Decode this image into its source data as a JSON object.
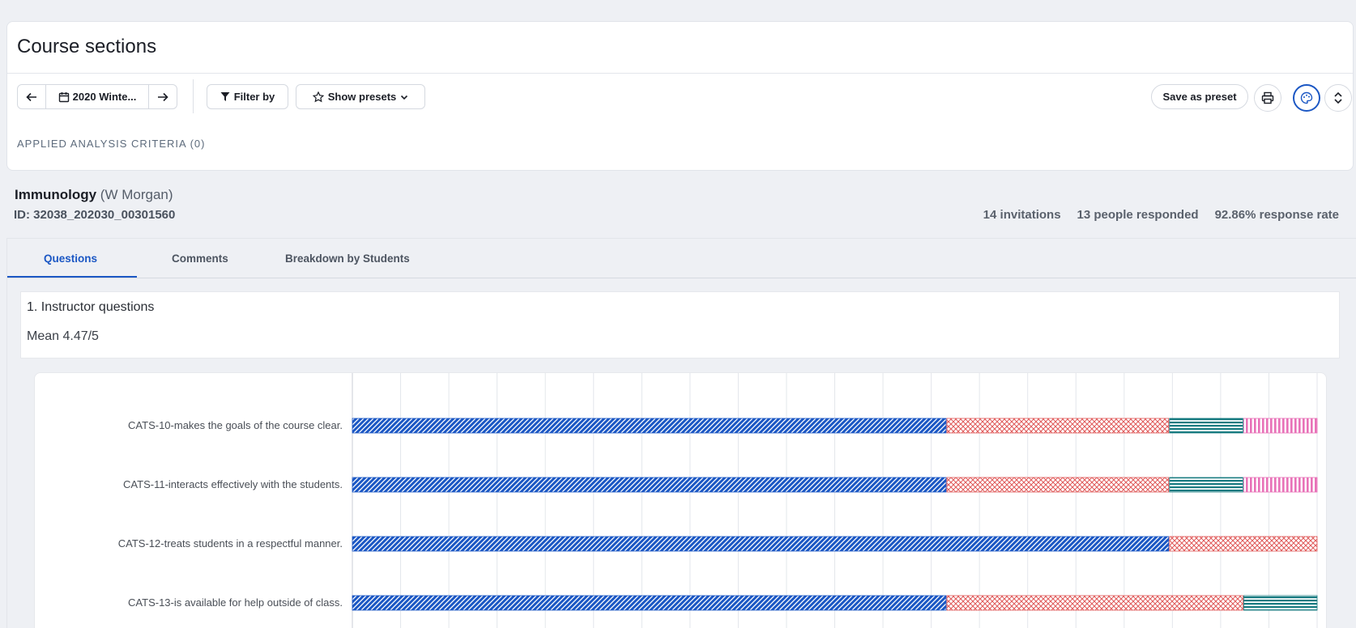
{
  "header": {
    "title": "Course sections"
  },
  "toolbar": {
    "term_label": "2020 Winte...",
    "filter_label": "Filter by",
    "presets_label": "Show presets",
    "save_label": "Save as preset"
  },
  "criteria": {
    "label": "APPLIED ANALYSIS CRITERIA (0)"
  },
  "course": {
    "name": "Immunology",
    "instructor": "(W Morgan)",
    "id": "ID: 32038_202030_00301560",
    "invitations": "14 invitations",
    "responded": "13 people responded",
    "response_rate": "92.86% response rate"
  },
  "tabs": [
    {
      "label": "Questions",
      "active": true
    },
    {
      "label": "Comments",
      "active": false
    },
    {
      "label": "Breakdown by Students",
      "active": false
    }
  ],
  "question": {
    "title": "1. Instructor questions",
    "mean": "Mean 4.47/5"
  },
  "icons": {
    "prev": "arrow-left-icon",
    "next": "arrow-right-icon",
    "calendar": "calendar-icon",
    "filter": "filter-icon",
    "star": "star-icon",
    "chevron": "chevron-down-icon",
    "print": "printer-icon",
    "palette": "palette-icon",
    "expand": "expand-icon"
  },
  "colors": {
    "accent": "#1b57c4",
    "series": [
      "#1b57c4",
      "#e05a5a",
      "#177a80",
      "#e872b8"
    ]
  },
  "chart_data": {
    "type": "bar",
    "orientation": "horizontal",
    "stacked": true,
    "grid": true,
    "categories": [
      "CATS-10-makes the goals of the course clear.",
      "CATS-11-interacts effectively with the students.",
      "CATS-12-treats students in a respectful manner.",
      "CATS-13-is available for help outside of class."
    ],
    "series": [
      {
        "values": [
          8,
          8,
          11,
          8
        ],
        "color": "#1b57c4",
        "pattern": "diagonal-hatch"
      },
      {
        "values": [
          3,
          3,
          2,
          4
        ],
        "color": "#e05a5a",
        "pattern": "cross-hatch"
      },
      {
        "values": [
          1,
          1,
          0,
          1
        ],
        "color": "#177a80",
        "pattern": "horizontal-stripes"
      },
      {
        "values": [
          1,
          1,
          0,
          0
        ],
        "color": "#e872b8",
        "pattern": "vertical-stripes"
      }
    ],
    "xlim": [
      0,
      13
    ]
  }
}
